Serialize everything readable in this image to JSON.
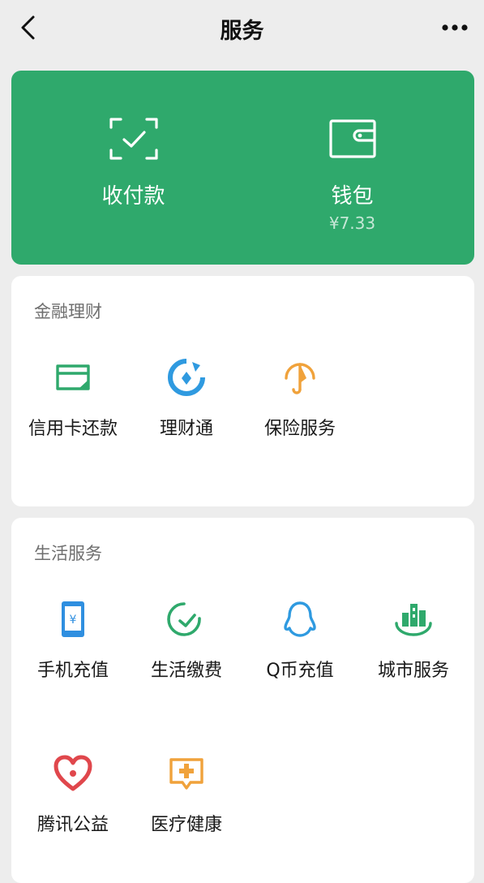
{
  "nav": {
    "back_icon": "chevron-left-icon",
    "title": "服务",
    "more_icon": "ellipsis-icon"
  },
  "wallet_card": {
    "background": "#2fa96c",
    "items": [
      {
        "label": "收付款",
        "icon": "scan-check-icon"
      },
      {
        "label": "钱包",
        "icon": "wallet-icon",
        "sub": "¥7.33"
      }
    ]
  },
  "finance": {
    "title": "金融理财",
    "items": [
      {
        "label": "信用卡还款",
        "icon": "credit-card-icon",
        "color": "#2fa96c"
      },
      {
        "label": "理财通",
        "icon": "wealth-icon",
        "color": "#2f9ae0"
      },
      {
        "label": "保险服务",
        "icon": "umbrella-icon",
        "color": "#f0a23b"
      }
    ]
  },
  "life": {
    "title": "生活服务",
    "items": [
      {
        "label": "手机充值",
        "icon": "mobile-topup-icon",
        "color": "#2f8fe0"
      },
      {
        "label": "生活缴费",
        "icon": "utility-pay-icon",
        "color": "#2fa96c"
      },
      {
        "label": "Q币充值",
        "icon": "qq-penguin-icon",
        "color": "#2f9ae0"
      },
      {
        "label": "城市服务",
        "icon": "city-buildings-icon",
        "color": "#2fa96c"
      },
      {
        "label": "腾讯公益",
        "icon": "charity-heart-icon",
        "color": "#e0474c"
      },
      {
        "label": "医疗健康",
        "icon": "medical-plus-icon",
        "color": "#f0a23b"
      }
    ]
  }
}
